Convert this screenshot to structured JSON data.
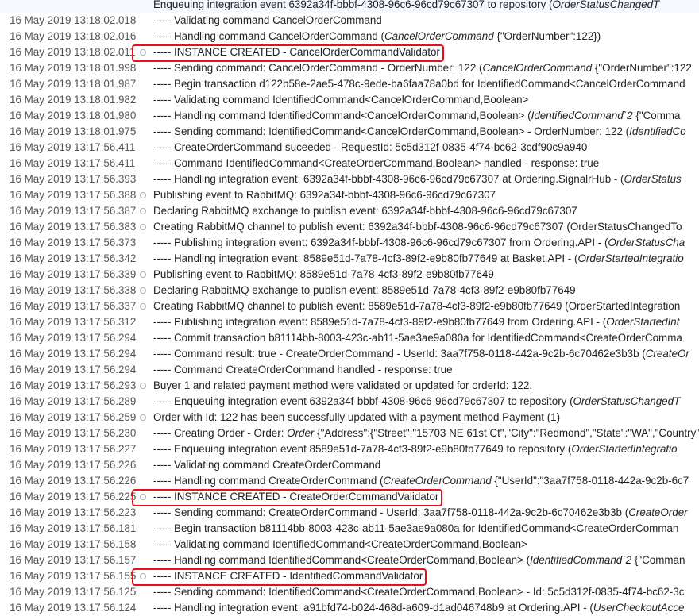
{
  "log_entries": [
    {
      "ts": "",
      "marker": false,
      "segments": [
        {
          "t": "Enqueuing integration event 6392a34f-bbbf-4308-96c6-96cd79c67307 to repository (",
          "i": false
        },
        {
          "t": "OrderStatusChangedT",
          "i": true
        }
      ]
    },
    {
      "ts": "16 May 2019  13:18:02.018",
      "marker": false,
      "segments": [
        {
          "t": "----- Validating command CancelOrderCommand",
          "i": false
        }
      ]
    },
    {
      "ts": "16 May 2019  13:18:02.016",
      "marker": false,
      "segments": [
        {
          "t": "----- Handling command CancelOrderCommand (",
          "i": false
        },
        {
          "t": "CancelOrderCommand",
          "i": true
        },
        {
          "t": " {\"OrderNumber\":122})",
          "i": false
        }
      ]
    },
    {
      "ts": "16 May 2019  13:18:02.011",
      "marker": true,
      "highlight": true,
      "segments": [
        {
          "t": "----- INSTANCE CREATED - CancelOrderCommandValidator",
          "i": false
        }
      ]
    },
    {
      "ts": "16 May 2019  13:18:01.998",
      "marker": false,
      "segments": [
        {
          "t": "----- Sending command: CancelOrderCommand - OrderNumber: 122 (",
          "i": false
        },
        {
          "t": "CancelOrderCommand",
          "i": true
        },
        {
          "t": " {\"OrderNumber\":122",
          "i": false
        }
      ]
    },
    {
      "ts": "16 May 2019  13:18:01.987",
      "marker": false,
      "segments": [
        {
          "t": "----- Begin transaction d122b58e-2ae5-478c-9ede-ba6faa78a0bd for IdentifiedCommand<CancelOrderCommand",
          "i": false
        }
      ]
    },
    {
      "ts": "16 May 2019  13:18:01.982",
      "marker": false,
      "segments": [
        {
          "t": "----- Validating command IdentifiedCommand<CancelOrderCommand,Boolean>",
          "i": false
        }
      ]
    },
    {
      "ts": "16 May 2019  13:18:01.980",
      "marker": false,
      "segments": [
        {
          "t": "----- Handling command IdentifiedCommand<CancelOrderCommand,Boolean> (",
          "i": false
        },
        {
          "t": "IdentifiedCommand`2",
          "i": true
        },
        {
          "t": " {\"Comma",
          "i": false
        }
      ]
    },
    {
      "ts": "16 May 2019  13:18:01.975",
      "marker": false,
      "segments": [
        {
          "t": "----- Sending command: IdentifiedCommand<CancelOrderCommand,Boolean> - OrderNumber: 122 (",
          "i": false
        },
        {
          "t": "IdentifiedCo",
          "i": true
        }
      ]
    },
    {
      "ts": "16 May 2019  13:17:56.411",
      "marker": false,
      "segments": [
        {
          "t": "----- CreateOrderCommand suceeded - RequestId: 5c5d312f-0835-4f74-bc62-3cdf90c9a940",
          "i": false
        }
      ]
    },
    {
      "ts": "16 May 2019  13:17:56.411",
      "marker": false,
      "segments": [
        {
          "t": "----- Command IdentifiedCommand<CreateOrderCommand,Boolean> handled - response: true",
          "i": false
        }
      ]
    },
    {
      "ts": "16 May 2019  13:17:56.393",
      "marker": false,
      "segments": [
        {
          "t": "----- Handling integration event: 6392a34f-bbbf-4308-96c6-96cd79c67307 at Ordering.SignalrHub - (",
          "i": false
        },
        {
          "t": "OrderStatus",
          "i": true
        }
      ]
    },
    {
      "ts": "16 May 2019  13:17:56.388",
      "marker": true,
      "segments": [
        {
          "t": "Publishing event to RabbitMQ: 6392a34f-bbbf-4308-96c6-96cd79c67307",
          "i": false
        }
      ]
    },
    {
      "ts": "16 May 2019  13:17:56.387",
      "marker": true,
      "segments": [
        {
          "t": "Declaring RabbitMQ exchange to publish event: 6392a34f-bbbf-4308-96c6-96cd79c67307",
          "i": false
        }
      ]
    },
    {
      "ts": "16 May 2019  13:17:56.383",
      "marker": true,
      "segments": [
        {
          "t": "Creating RabbitMQ channel to publish event: 6392a34f-bbbf-4308-96c6-96cd79c67307 (OrderStatusChangedTo",
          "i": false
        }
      ]
    },
    {
      "ts": "16 May 2019  13:17:56.373",
      "marker": false,
      "segments": [
        {
          "t": "----- Publishing integration event: 6392a34f-bbbf-4308-96c6-96cd79c67307 from Ordering.API - (",
          "i": false
        },
        {
          "t": "OrderStatusCha",
          "i": true
        }
      ]
    },
    {
      "ts": "16 May 2019  13:17:56.342",
      "marker": false,
      "segments": [
        {
          "t": "----- Handling integration event: 8589e51d-7a78-4cf3-89f2-e9b80fb77649 at Basket.API - (",
          "i": false
        },
        {
          "t": "OrderStartedIntegratio",
          "i": true
        }
      ]
    },
    {
      "ts": "16 May 2019  13:17:56.339",
      "marker": true,
      "segments": [
        {
          "t": "Publishing event to RabbitMQ: 8589e51d-7a78-4cf3-89f2-e9b80fb77649",
          "i": false
        }
      ]
    },
    {
      "ts": "16 May 2019  13:17:56.338",
      "marker": true,
      "segments": [
        {
          "t": "Declaring RabbitMQ exchange to publish event: 8589e51d-7a78-4cf3-89f2-e9b80fb77649",
          "i": false
        }
      ]
    },
    {
      "ts": "16 May 2019  13:17:56.337",
      "marker": true,
      "segments": [
        {
          "t": "Creating RabbitMQ channel to publish event: 8589e51d-7a78-4cf3-89f2-e9b80fb77649 (OrderStartedIntegration",
          "i": false
        }
      ]
    },
    {
      "ts": "16 May 2019  13:17:56.312",
      "marker": false,
      "segments": [
        {
          "t": "----- Publishing integration event: 8589e51d-7a78-4cf3-89f2-e9b80fb77649 from Ordering.API - (",
          "i": false
        },
        {
          "t": "OrderStartedInt",
          "i": true
        }
      ]
    },
    {
      "ts": "16 May 2019  13:17:56.294",
      "marker": false,
      "segments": [
        {
          "t": "----- Commit transaction b81114bb-8003-423c-ab11-5ae3ae9a080a for IdentifiedCommand<CreateOrderComma",
          "i": false
        }
      ]
    },
    {
      "ts": "16 May 2019  13:17:56.294",
      "marker": false,
      "segments": [
        {
          "t": "----- Command result: true - CreateOrderCommand - UserId: 3aa7f758-0118-442a-9c2b-6c70462e3b3b (",
          "i": false
        },
        {
          "t": "CreateOr",
          "i": true
        }
      ]
    },
    {
      "ts": "16 May 2019  13:17:56.294",
      "marker": false,
      "segments": [
        {
          "t": "----- Command CreateOrderCommand handled - response: true",
          "i": false
        }
      ]
    },
    {
      "ts": "16 May 2019  13:17:56.293",
      "marker": true,
      "segments": [
        {
          "t": "Buyer 1 and related payment method were validated or updated for orderId: 122.",
          "i": false
        }
      ]
    },
    {
      "ts": "16 May 2019  13:17:56.289",
      "marker": false,
      "segments": [
        {
          "t": "----- Enqueuing integration event 6392a34f-bbbf-4308-96c6-96cd79c67307 to repository (",
          "i": false
        },
        {
          "t": "OrderStatusChangedT",
          "i": true
        }
      ]
    },
    {
      "ts": "16 May 2019  13:17:56.259",
      "marker": true,
      "segments": [
        {
          "t": "Order with Id: 122 has been successfully updated with a payment method Payment (1)",
          "i": false
        }
      ]
    },
    {
      "ts": "16 May 2019  13:17:56.230",
      "marker": false,
      "segments": [
        {
          "t": "----- Creating Order - Order: ",
          "i": false
        },
        {
          "t": "Order",
          "i": true
        },
        {
          "t": " {\"Address\":{\"Street\":\"15703 NE 61st Ct\",\"City\":\"Redmond\",\"State\":\"WA\",\"Country\":",
          "i": false
        }
      ]
    },
    {
      "ts": "16 May 2019  13:17:56.227",
      "marker": false,
      "segments": [
        {
          "t": "----- Enqueuing integration event 8589e51d-7a78-4cf3-89f2-e9b80fb77649 to repository (",
          "i": false
        },
        {
          "t": "OrderStartedIntegratio",
          "i": true
        }
      ]
    },
    {
      "ts": "16 May 2019  13:17:56.226",
      "marker": false,
      "segments": [
        {
          "t": "----- Validating command CreateOrderCommand",
          "i": false
        }
      ]
    },
    {
      "ts": "16 May 2019  13:17:56.226",
      "marker": false,
      "segments": [
        {
          "t": "----- Handling command CreateOrderCommand (",
          "i": false
        },
        {
          "t": "CreateOrderCommand",
          "i": true
        },
        {
          "t": " {\"UserId\":\"3aa7f758-0118-442a-9c2b-6c7",
          "i": false
        }
      ]
    },
    {
      "ts": "16 May 2019  13:17:56.225",
      "marker": true,
      "highlight": true,
      "segments": [
        {
          "t": "----- INSTANCE CREATED - CreateOrderCommandValidator",
          "i": false
        }
      ]
    },
    {
      "ts": "16 May 2019  13:17:56.223",
      "marker": false,
      "segments": [
        {
          "t": "----- Sending command: CreateOrderCommand - UserId: 3aa7f758-0118-442a-9c2b-6c70462e3b3b (",
          "i": false
        },
        {
          "t": "CreateOrder",
          "i": true
        }
      ]
    },
    {
      "ts": "16 May 2019  13:17:56.181",
      "marker": false,
      "segments": [
        {
          "t": "----- Begin transaction b81114bb-8003-423c-ab11-5ae3ae9a080a for IdentifiedCommand<CreateOrderComman",
          "i": false
        }
      ]
    },
    {
      "ts": "16 May 2019  13:17:56.158",
      "marker": false,
      "segments": [
        {
          "t": "----- Validating command IdentifiedCommand<CreateOrderCommand,Boolean>",
          "i": false
        }
      ]
    },
    {
      "ts": "16 May 2019  13:17:56.157",
      "marker": false,
      "segments": [
        {
          "t": "----- Handling command IdentifiedCommand<CreateOrderCommand,Boolean> (",
          "i": false
        },
        {
          "t": "IdentifiedCommand`2",
          "i": true
        },
        {
          "t": " {\"Comman",
          "i": false
        }
      ]
    },
    {
      "ts": "16 May 2019  13:17:56.155",
      "marker": true,
      "highlight": true,
      "segments": [
        {
          "t": "----- INSTANCE CREATED - IdentifiedCommandValidator",
          "i": false
        }
      ]
    },
    {
      "ts": "16 May 2019  13:17:56.125",
      "marker": false,
      "segments": [
        {
          "t": "----- Sending command: IdentifiedCommand<CreateOrderCommand,Boolean> - Id: 5c5d312f-0835-4f74-bc62-3c",
          "i": false
        }
      ]
    },
    {
      "ts": "16 May 2019  13:17:56.124",
      "marker": false,
      "segments": [
        {
          "t": "----- Handling integration event: a91bfd74-b024-468d-a609-d1ad046748b9 at Ordering.API - (",
          "i": false
        },
        {
          "t": "UserCheckoutAcce",
          "i": true
        }
      ]
    }
  ],
  "colors": {
    "highlight_border": "#e5101a",
    "marker_border": "#b0b0b0",
    "timestamp_text": "#555555",
    "message_text": "#222222"
  }
}
